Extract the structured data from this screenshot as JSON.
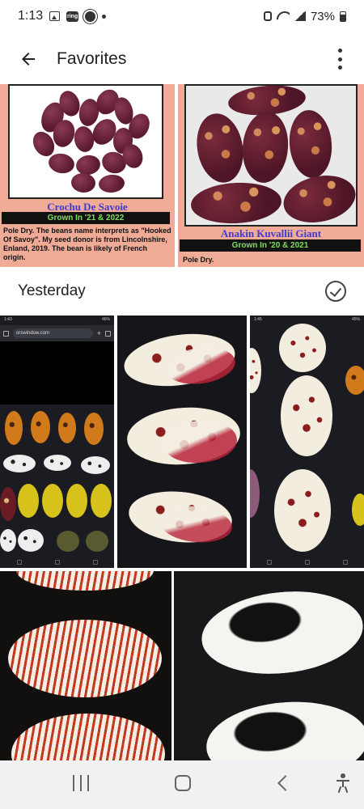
{
  "status_bar": {
    "time": "1:13",
    "ring_label": "ring",
    "battery": "73%"
  },
  "app_bar": {
    "title": "Favorites"
  },
  "favorites": [
    {
      "name": "Crochu De Savoie",
      "grown": "Grown In '21 & 2022",
      "description": "Pole Dry. The beans name interprets as \"Hooked Of Savoy\". My seed donor is from Lincolnshire, Enland, 2019. The bean is likely of French origin."
    },
    {
      "name": "Anakin Kuvallii Giant",
      "grown": "Grown In '20 & 2021",
      "description": "Pole Dry."
    }
  ],
  "section": {
    "label": "Yesterday"
  },
  "screenshot_tiles": {
    "url": "orswindow.com",
    "time_left": "1:43",
    "time_right": "1:45",
    "battery_left": "46%",
    "battery_right": "45%"
  },
  "icons": {
    "back": "arrow-back-icon",
    "more": "more-vert-icon",
    "select": "check-circle-icon",
    "recents": "recents-icon",
    "home": "home-icon",
    "nav_back": "nav-back-icon",
    "accessibility": "accessibility-icon"
  }
}
